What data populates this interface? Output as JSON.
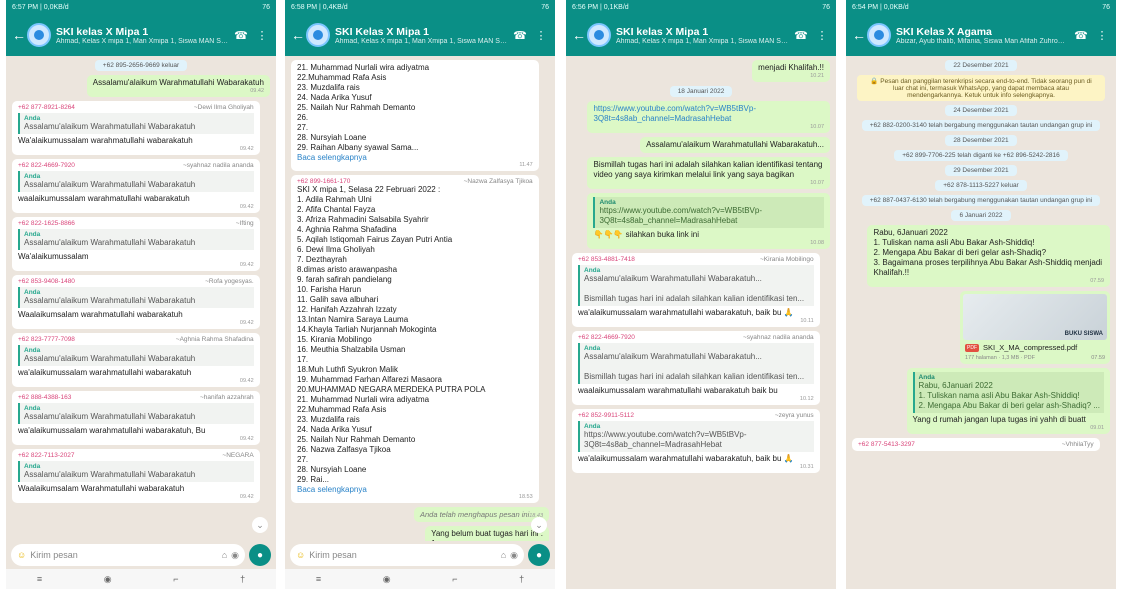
{
  "screens": [
    {
      "status": {
        "time": "6:57 PM | 0,0KB/d",
        "battery": "76"
      },
      "header": {
        "title": "SKI kelas X Mipa 1",
        "subtitle": "Ahmad, Kelas X mipa 1, Man Xmipa 1, Siswa MAN Syahnaz..."
      },
      "messages": [
        {
          "kind": "sys",
          "text": "+62 895-2656-9669 keluar"
        },
        {
          "kind": "out",
          "text": "Assalamu'alaikum Warahmatullahi Wabarakatuh",
          "time": "09.42"
        },
        {
          "kind": "in",
          "phone": "+62 877-8921-8264",
          "name": "~Dewi Ilma Gholiyah",
          "quote_author": "Anda",
          "quote": "Assalamu'alaikum Warahmatullahi Wabarakatuh",
          "text": "Wa'alaikumussalam warahmatullahi wabarakatuh",
          "time": "09.42"
        },
        {
          "kind": "in",
          "phone": "+62 822-4669-7920",
          "name": "~syahnaz nadila ananda",
          "quote_author": "Anda",
          "quote": "Assalamu'alaikum Warahmatullahi Wabarakatuh",
          "text": "waalaikumussalam warahmatullahi wabarakatuh",
          "time": "09.42"
        },
        {
          "kind": "in",
          "phone": "+62 822-1625-8866",
          "name": "~Ifting",
          "quote_author": "Anda",
          "quote": "Assalamu'alaikum Warahmatullahi Wabarakatuh",
          "text": "Wa'alaikumussalam",
          "time": "09.42"
        },
        {
          "kind": "in",
          "phone": "+62 853-9408-1480",
          "name": "~Rofa yogesyas.",
          "quote_author": "Anda",
          "quote": "Assalamu'alaikum Warahmatullahi Wabarakatuh",
          "text": "Waalaikumsalam warahmatullahi wabarakatuh",
          "time": "09.42"
        },
        {
          "kind": "in",
          "phone": "+62 823-7777-7098",
          "name": "~Aghnia Rahma Shafadina",
          "quote_author": "Anda",
          "quote": "Assalamu'alaikum Warahmatullahi Wabarakatuh",
          "text": "wa'alaikumussalam warahmatullahi wabarakatuh",
          "time": "09.42"
        },
        {
          "kind": "in",
          "phone": "+62 888-4388-163",
          "name": "~hanifah azzahrah",
          "quote_author": "Anda",
          "quote": "Assalamu'alaikum Warahmatullahi Wabarakatuh",
          "text": "wa'alaikumussalam warahmatullahi wabarakatuh, Bu",
          "time": "09.42"
        },
        {
          "kind": "in",
          "phone": "+62 822-7113-2027",
          "name": "~NEGARA",
          "quote_author": "Anda",
          "quote": "Assalamu'alaikum Warahmatullahi Wabarakatuh",
          "text": "Waalaikumsalam Warahmatullahi wabarakatuh",
          "time": "09.42"
        }
      ],
      "composer": {
        "placeholder": "Kirim pesan"
      }
    },
    {
      "status": {
        "time": "6:58 PM | 0,4KB/d",
        "battery": "76"
      },
      "header": {
        "title": "SKI Kelas X Mipa 1",
        "subtitle": "Ahmad, Kelas X mipa 1, Man Xmipa 1, Siswa MAN Syahnaz..."
      },
      "messages": [
        {
          "kind": "in",
          "phone": "",
          "name": "",
          "quote_author": "",
          "quote": "",
          "text": "21. Muhammad Nurlali wira adiyatma\n22.Muhammad Rafa Asis\n23. Muzdalifa rais\n24. Nada Arika Yusuf\n25. Nailah Nur Rahmah Demanto\n26.\n27.\n28. Nursyiah Loane\n29. Raihan Albany syawal Sama...",
          "more": "Baca selengkapnya",
          "time": "11.47"
        },
        {
          "kind": "in",
          "phone": "+62 899-1661-170",
          "name": "~Nazwa Zalfasya Tjikoa",
          "quote_author": "",
          "quote": "",
          "text": "SKI X mipa 1, Selasa 22 Februari 2022 :\n1. Adila Rahmah Ulni\n2. Afifa Chantal Fayza\n3. Afriza Rahmadini Salsabila Syahrir\n4. Aghnia Rahma Shafadina\n5. Aqilah Istiqomah Fairus Zayan Putri Antia\n6. Dewi Ilma Gholiyah\n7. Dezthayrah\n8.dimas aristo arawanpasha\n9. farah safirah pandielang\n10. Farisha Harun\n11. Galih sava albuhari\n12. Hanifah Azzahrah Izzaty\n13.Intan Namira Saraya Lauma\n14.Khayla Tarliah Nurjannah Mokoginta\n15. Kirania Mobilingo\n16. Meuthia Shalzabila Usman\n17.\n18.Muh Luthfi Syukron Malik\n19. Muhammad Farhan Alfarezi Masaora\n20.MUHAMMAD NEGARA MERDEKA PUTRA POLA\n21. Muhammad Nurlali wira adiyatma\n22.Muhammad Rafa Asis\n23. Muzdalifa rais\n24. Nada Arika Yusuf\n25. Nailah Nur Rahmah Demanto\n26. Nazwa Zalfasya Tjikoa\n27.\n28. Nursyiah Loane\n29. Rai...",
          "more": "Baca selengkapnya",
          "time": "18.53"
        },
        {
          "kind": "del",
          "text": "Anda telah menghapus pesan ini",
          "time": "18.43"
        },
        {
          "kind": "out",
          "text": "Yang belum buat tugas hari ini :\n1.",
          "time": ""
        }
      ],
      "composer": {
        "placeholder": "Kirim pesan"
      }
    },
    {
      "status": {
        "time": "6:56 PM | 0,1KB/d",
        "battery": "76"
      },
      "header": {
        "title": "SKI kelas X Mipa 1",
        "subtitle": "Ahmad, Kelas X mipa 1, Man Xmipa 1, Siswa MAN Syahnaz..."
      },
      "messages": [
        {
          "kind": "out",
          "text": "menjadi Khalifah.!!",
          "time": "10.21"
        },
        {
          "kind": "sys",
          "text": "18 Januari 2022"
        },
        {
          "kind": "out",
          "link": "https://www.youtube.com/watch?v=WB5tBVp-3Q8t=4s8ab_channel=MadrasahHebat",
          "text": "",
          "time": "10.07"
        },
        {
          "kind": "out",
          "text": "Assalamu'alaikum Warahmatullahi Wabarakatuh...",
          "time": ""
        },
        {
          "kind": "out",
          "text": "Bismillah tugas hari ini adalah silahkan kalian identifikasi tentang video yang saya kirimkan melalui link yang saya bagikan",
          "time": "10.07"
        },
        {
          "kind": "out",
          "quote_author": "Anda",
          "quote": "https://www.youtube.com/watch?v=WB5tBVp-3Q8t=4s8ab_channel=MadrasahHebat",
          "text": "👇👇👇 silahkan buka link ini",
          "time": "10.08"
        },
        {
          "kind": "in",
          "phone": "+62 853-4881-7418",
          "name": "~Kirania Mobilingo",
          "quote_author": "Anda",
          "quote": "Assalamu'alaikum Warahmatullahi Wabarakatuh...\n\nBismillah tugas hari ini adalah silahkan kalian identifikasi ten...",
          "text": "wa'alaikumussalam warahmatullahi wabarakatuh, baik bu 🙏",
          "time": "10.11"
        },
        {
          "kind": "in",
          "phone": "+62 822-4669-7920",
          "name": "~syahnaz nadila ananda",
          "quote_author": "Anda",
          "quote": "Assalamu'alaikum Warahmatullahi Wabarakatuh...\n\nBismillah tugas hari ini adalah silahkan kalian identifikasi ten...",
          "text": "waalaikumussalam warahmatullahi wabarakatuh baik bu",
          "time": "10.12"
        },
        {
          "kind": "in",
          "phone": "+62 852-9911-5112",
          "name": "~zeyra yunus",
          "quote_author": "Anda",
          "quote": "https://www.youtube.com/watch?v=WB5tBVp-3Q8t=4s8ab_channel=MadrasahHebat",
          "text": "wa'alaikumussalam warahmatullahi wabarakatuh, baik bu 🙏",
          "time": "10.31"
        }
      ],
      "composer": {
        "placeholder": ""
      }
    },
    {
      "status": {
        "time": "6:54 PM | 0,0KB/d",
        "battery": "76"
      },
      "header": {
        "title": "SKI Kelas X Agama",
        "subtitle": "Abizar, Ayub thalib, Mifania, Siswa Man Afifah Zuhroh, ..."
      },
      "messages": [
        {
          "kind": "sys",
          "text": "22 Desember 2021"
        },
        {
          "kind": "sys warn",
          "text": "🔒 Pesan dan panggilan terenkripsi secara end-to-end. Tidak seorang pun di luar chat ini, termasuk WhatsApp, yang dapat membaca atau mendengarkannya. Ketuk untuk info selengkapnya."
        },
        {
          "kind": "sys",
          "text": "24 Desember 2021"
        },
        {
          "kind": "sys",
          "text": "+62 882-0200-3140 telah bergabung menggunakan tautan undangan grup ini"
        },
        {
          "kind": "sys",
          "text": "28 Desember 2021"
        },
        {
          "kind": "sys",
          "text": "+62 899-7706-225 telah diganti ke +62 896-5242-2816"
        },
        {
          "kind": "sys",
          "text": "29 Desember 2021"
        },
        {
          "kind": "sys",
          "text": "+62 878-1113-5227 keluar"
        },
        {
          "kind": "sys",
          "text": "+62 887-0437-6130 telah bergabung menggunakan tautan undangan grup ini"
        },
        {
          "kind": "sys",
          "text": "6 Januari 2022"
        },
        {
          "kind": "out",
          "text": "Rabu, 6Januari 2022\n1. Tuliskan nama asli Abu Bakar Ash-Shiddiq!\n2. Mengapa  Abu Bakar di beri gelar ash-Shadiq?\n3. Bagaimana proses terpilihnya Abu Bakar Ash-Shiddiq menjadi Khalifah.!!",
          "time": "07.59"
        },
        {
          "kind": "doc",
          "preview": "BUKU SISWA",
          "file": "SKI_X_MA_compressed.pdf",
          "meta": "177 halaman · 1,3 MB · PDF",
          "time": "07.59"
        },
        {
          "kind": "out",
          "quote_author": "Anda",
          "quote": "Rabu, 6Januari 2022\n1. Tuliskan nama asli Abu Bakar Ash-Shiddiq!\n2. Mengapa  Abu Bakar di beri gelar ash-Shadiq? ...",
          "text": "Yang d rumah jangan lupa tugas ini yahh di buatt",
          "time": "09.01"
        },
        {
          "kind": "in",
          "phone": "+62 877-5413-3297",
          "name": "~VhhilaTyy",
          "quote_author": "",
          "quote": "",
          "text": "",
          "time": ""
        }
      ],
      "composer": {
        "placeholder": ""
      }
    }
  ],
  "colors": {
    "header": "#0a8f86",
    "outgoing": "#dcf8c6",
    "incoming": "#ffffff",
    "chat_bg": "#ece5dd"
  },
  "icons": {
    "back": "arrow-left-icon",
    "call": "call-add-icon",
    "menu": "more-vert-icon",
    "emoji": "emoji-icon",
    "attach": "paperclip-icon",
    "camera": "camera-icon",
    "mic": "mic-icon",
    "scroll": "chevron-down-icon"
  }
}
